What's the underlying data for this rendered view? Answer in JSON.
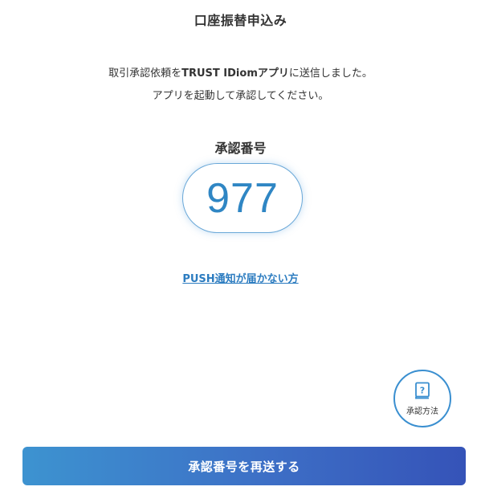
{
  "header": {
    "title": "口座振替申込み"
  },
  "message": {
    "line1_prefix": "取引承認依頼を",
    "line1_app": "TRUST IDiomアプリ",
    "line1_suffix": "に送信しました。",
    "line2": "アプリを起動して承認してください。"
  },
  "approval": {
    "label": "承認番号",
    "code": "977"
  },
  "push_link": {
    "label": "PUSH通知が届かない方"
  },
  "help": {
    "icon": "book-question-icon",
    "icon_glyph": "?",
    "label": "承認方法"
  },
  "resend_button": {
    "label": "承認番号を再送する"
  },
  "colors": {
    "accent": "#2f86c4",
    "link": "#2c7cc0",
    "button_start": "#3d93d0",
    "button_end": "#3553b8"
  }
}
